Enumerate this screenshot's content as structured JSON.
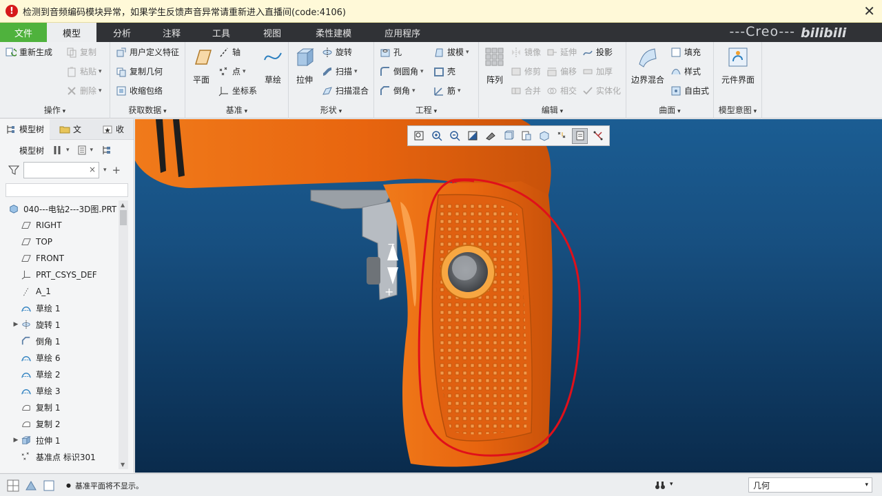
{
  "warning": {
    "icon": "error-icon",
    "text": "检测到音频编码模块异常，如果学生反馈声音异常请重新进入直播间(code:4106)",
    "close": "✕"
  },
  "menu": {
    "tabs": [
      "文件",
      "模型",
      "分析",
      "注释",
      "工具",
      "视图",
      "柔性建模",
      "应用程序"
    ],
    "brand": "---Creo---",
    "watermark": "bilibili"
  },
  "ribbon": {
    "operations": {
      "label": "操作",
      "regen": "重新生成",
      "copy": "复制",
      "paste": "粘贴",
      "delete": "删除"
    },
    "getdata": {
      "label": "获取数据",
      "udf": "用户定义特征",
      "copygeom": "复制几何",
      "shrinkwrap": "收缩包络"
    },
    "datum": {
      "label": "基准",
      "plane": "平面",
      "axis": "轴",
      "point": "点",
      "csys": "坐标系",
      "sketch": "草绘"
    },
    "shapes": {
      "label": "形状",
      "extrude": "拉伸",
      "revolve": "旋转",
      "sweep": "扫描",
      "swept_blend": "扫描混合"
    },
    "engineering": {
      "label": "工程",
      "hole": "孔",
      "round": "倒圆角",
      "chamfer": "倒角",
      "draft": "拔模",
      "shell": "壳",
      "rib": "筋"
    },
    "editing": {
      "label": "编辑",
      "pattern": "阵列",
      "mirror": "镜像",
      "trim": "修剪",
      "merge": "合并",
      "extend": "延伸",
      "offset": "偏移",
      "intersect": "相交",
      "project": "投影",
      "thicken": "加厚",
      "solidify": "实体化"
    },
    "surfaces": {
      "label": "曲面",
      "boundary": "边界混合",
      "fill": "填充",
      "style": "样式",
      "freestyle": "自由式"
    },
    "intent": {
      "label": "模型意图",
      "component": "元件界面"
    }
  },
  "panel": {
    "tabs": [
      "模型树",
      "文",
      "收"
    ],
    "toolbar_label": "模型树",
    "tree": [
      {
        "label": "040---电钻2---3D图.PRT",
        "icon": "part-icon",
        "expand": false
      },
      {
        "label": "RIGHT",
        "icon": "datum-plane-icon",
        "expand": false
      },
      {
        "label": "TOP",
        "icon": "datum-plane-icon",
        "expand": false
      },
      {
        "label": "FRONT",
        "icon": "datum-plane-icon",
        "expand": false
      },
      {
        "label": "PRT_CSYS_DEF",
        "icon": "csys-icon",
        "expand": false
      },
      {
        "label": "A_1",
        "icon": "axis-icon",
        "expand": false
      },
      {
        "label": "草绘 1",
        "icon": "sketch-icon",
        "expand": false
      },
      {
        "label": "旋转 1",
        "icon": "revolve-icon",
        "expand": true
      },
      {
        "label": "倒角 1",
        "icon": "chamfer-icon",
        "expand": false
      },
      {
        "label": "草绘 6",
        "icon": "sketch-icon",
        "expand": false
      },
      {
        "label": "草绘 2",
        "icon": "sketch-icon",
        "expand": false
      },
      {
        "label": "草绘 3",
        "icon": "sketch-icon",
        "expand": false
      },
      {
        "label": "复制 1",
        "icon": "copy-surface-icon",
        "expand": false
      },
      {
        "label": "复制 2",
        "icon": "copy-surface-icon",
        "expand": false
      },
      {
        "label": "拉伸 1",
        "icon": "extrude-icon",
        "expand": true
      },
      {
        "label": "基准点 标识301",
        "icon": "datum-point-icon",
        "expand": false
      }
    ]
  },
  "status": {
    "message": "基准平面将不显示。",
    "filter": "几何"
  },
  "colors": {
    "accent_green": "#4fb23d",
    "model_orange": "#e8650f",
    "annotation_red": "#e0101a"
  }
}
